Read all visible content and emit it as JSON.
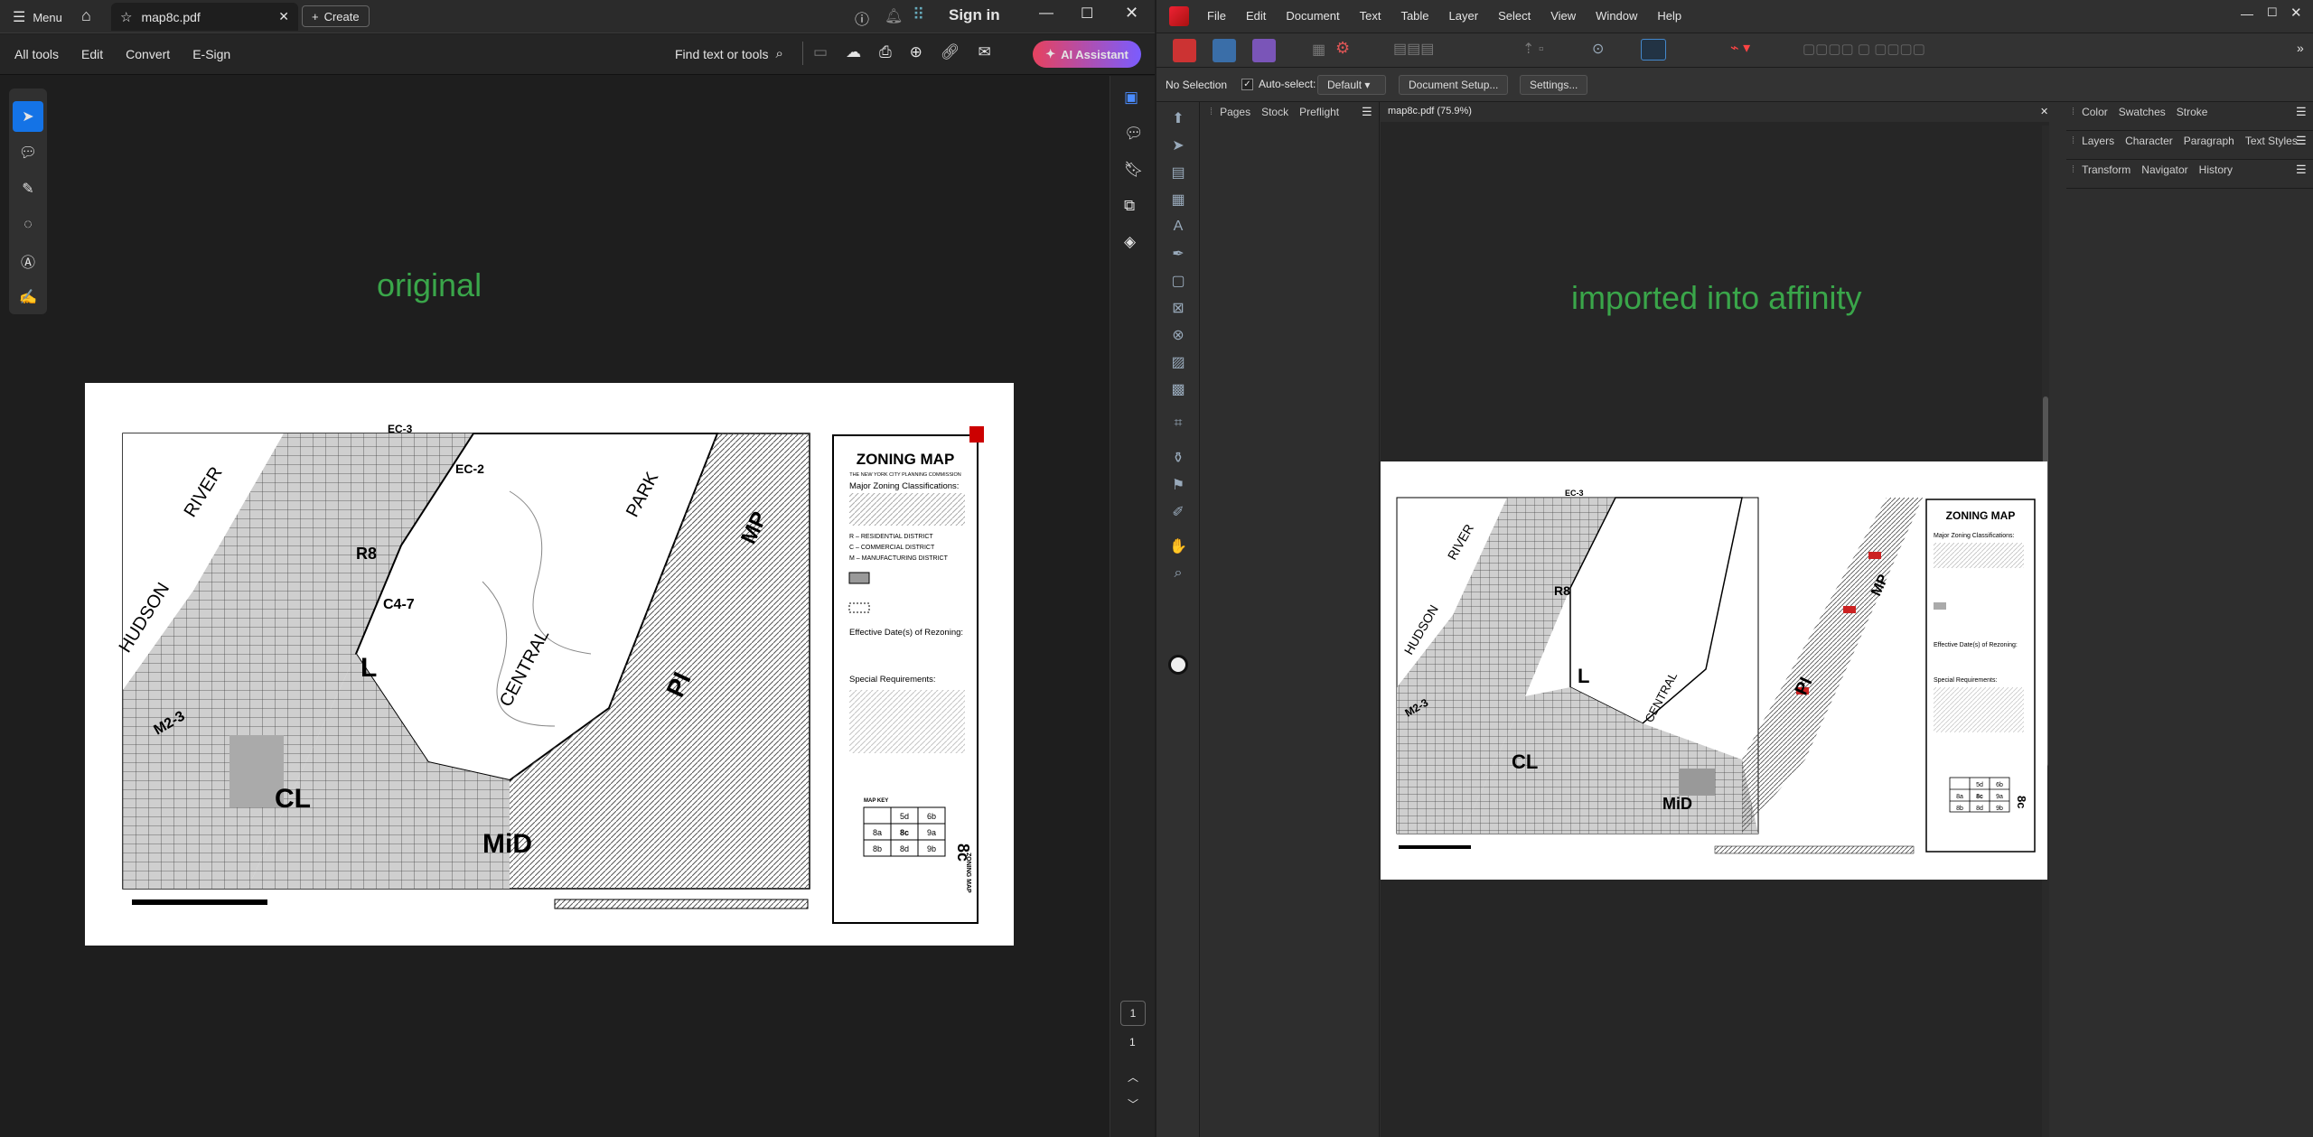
{
  "acrobat": {
    "menu_label": "Menu",
    "tab_label": "map8c.pdf",
    "create_label": "Create",
    "signin_label": "Sign in",
    "toolbar": [
      "All tools",
      "Edit",
      "Convert",
      "E-Sign"
    ],
    "find_label": "Find text or tools",
    "ai_label": "AI Assistant",
    "page_current": "1",
    "page_total": "1"
  },
  "affinity": {
    "menus": [
      "File",
      "Edit",
      "Document",
      "Text",
      "Table",
      "Layer",
      "Select",
      "View",
      "Window",
      "Help"
    ],
    "no_selection": "No Selection",
    "auto_select_label": "Auto-select:",
    "auto_select_value": "Default",
    "doc_setup_label": "Document Setup...",
    "settings_label": "Settings...",
    "left_tabs": [
      "Pages",
      "Stock",
      "Preflight"
    ],
    "doc_tab": "map8c.pdf (75.9%)",
    "panel_row1": [
      "Color",
      "Swatches",
      "Stroke"
    ],
    "panel_row2": [
      "Layers",
      "Character",
      "Paragraph",
      "Text Styles"
    ],
    "panel_row3": [
      "Transform",
      "Navigator",
      "History"
    ]
  },
  "labels": {
    "original": "original",
    "imported": "imported into affinity"
  },
  "map": {
    "title": "ZONING MAP",
    "subtitle": "THE NEW YORK CITY PLANNING COMMISSION",
    "major": "Major Zoning Classifications:",
    "legend": [
      "R – RESIDENTIAL DISTRICT",
      "C – COMMERCIAL DISTRICT",
      "M – MANUFACTURING DISTRICT"
    ],
    "effective": "Effective Date(s) of Rezoning:",
    "special": "Special Requirements:",
    "map_key": "MAP KEY",
    "key_cells": [
      "5d",
      "6b",
      "8a",
      "8c",
      "9a",
      "8b",
      "8d",
      "9b"
    ],
    "sheet": "8c",
    "sheet_label": "ZONING MAP",
    "areas": [
      "HUDSON",
      "RIVER",
      "CENTRAL",
      "PARK",
      "EC-3",
      "EC-2",
      "R8",
      "L",
      "CL",
      "MiD",
      "PI",
      "MP",
      "C4-7",
      "M2-3"
    ]
  }
}
